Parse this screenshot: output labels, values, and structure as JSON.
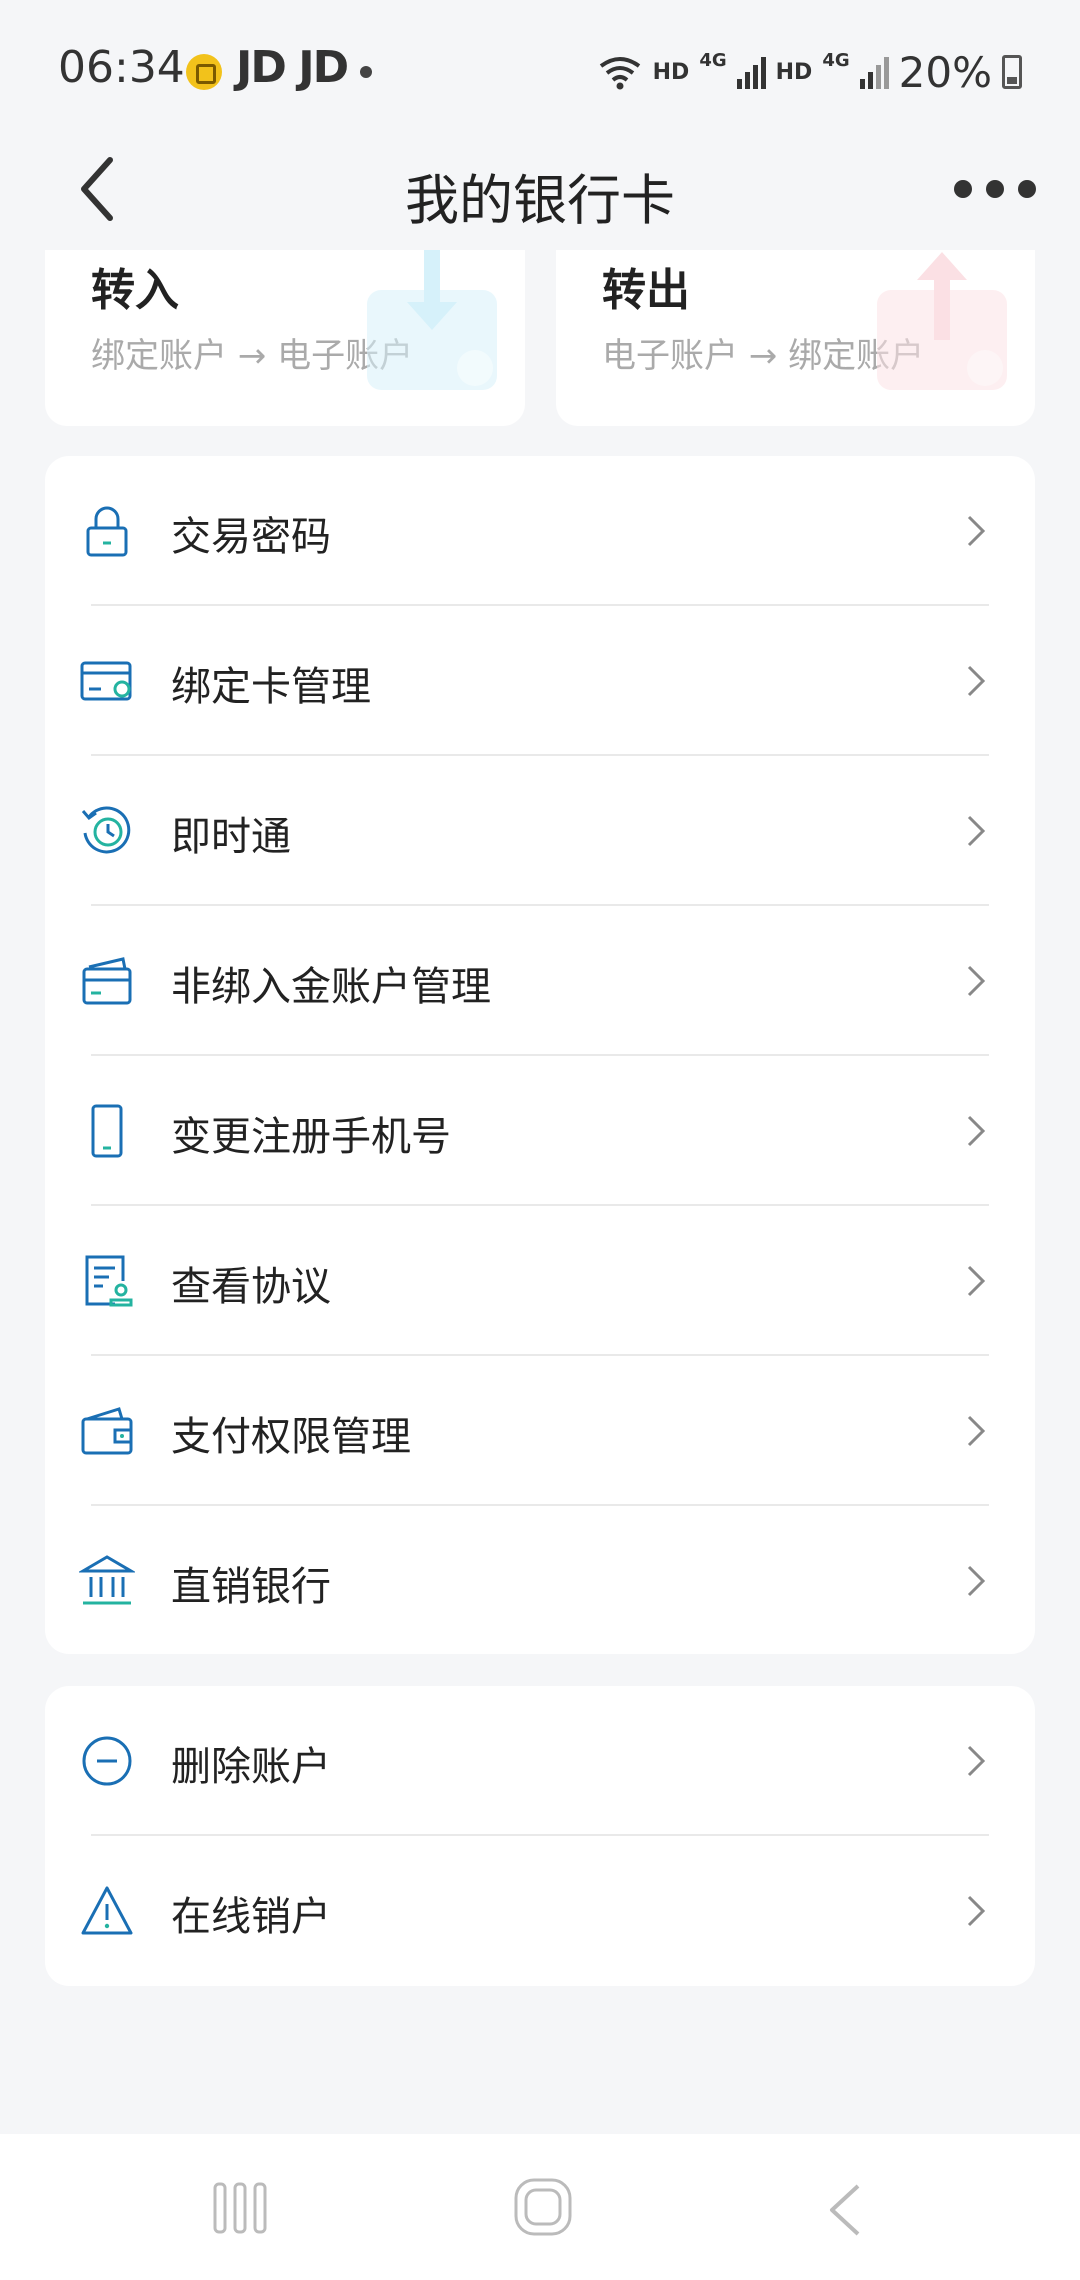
{
  "status_bar": {
    "time": "06:34",
    "carrier": "JD JD",
    "network_hd1": "HD",
    "network_4g1": "4G",
    "network_hd2": "HD",
    "network_4g2": "4G",
    "battery": "20%"
  },
  "header": {
    "title": "我的银行卡"
  },
  "transfer_cards": [
    {
      "title": "转入",
      "subtitle": "绑定账户 → 电子账户",
      "accent": "#3ab8e8"
    },
    {
      "title": "转出",
      "subtitle": "电子账户 → 绑定账户",
      "accent": "#f0707a"
    }
  ],
  "menu_main": [
    {
      "label": "交易密码",
      "icon": "lock-icon"
    },
    {
      "label": "绑定卡管理",
      "icon": "bound-card-icon"
    },
    {
      "label": "即时通",
      "icon": "clock-refresh-icon"
    },
    {
      "label": "非绑入金账户管理",
      "icon": "cards-icon"
    },
    {
      "label": "变更注册手机号",
      "icon": "phone-icon"
    },
    {
      "label": "查看协议",
      "icon": "agreement-icon"
    },
    {
      "label": "支付权限管理",
      "icon": "wallet-icon"
    },
    {
      "label": "直销银行",
      "icon": "bank-icon"
    }
  ],
  "menu_danger": [
    {
      "label": "删除账户",
      "icon": "minus-circle-icon"
    },
    {
      "label": "在线销户",
      "icon": "warning-icon"
    }
  ],
  "colors": {
    "icon_blue": "#1a6fb4",
    "icon_teal": "#24b3a0",
    "background": "#f5f6f8"
  }
}
